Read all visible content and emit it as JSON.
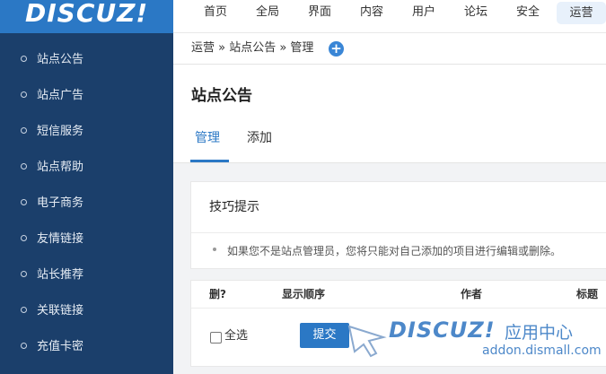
{
  "logo": {
    "text": "DISCUZ!"
  },
  "topnav": {
    "items": [
      "首页",
      "全局",
      "界面",
      "内容",
      "用户",
      "论坛",
      "安全",
      "运营"
    ],
    "active": "运营"
  },
  "sidebar": {
    "items": [
      "站点公告",
      "站点广告",
      "短信服务",
      "站点帮助",
      "电子商务",
      "友情链接",
      "站长推荐",
      "关联链接",
      "充值卡密"
    ]
  },
  "breadcrumb": {
    "text": "运营 » 站点公告 » 管理"
  },
  "page": {
    "title": "站点公告",
    "tabs": [
      "管理",
      "添加"
    ]
  },
  "tips": {
    "title": "技巧提示",
    "text": "如果您不是站点管理员，您将只能对自己添加的项目进行编辑或删除。"
  },
  "table": {
    "headers": [
      "删?",
      "显示顺序",
      "作者",
      "标题"
    ],
    "select_all": "全选",
    "submit": "提交"
  },
  "watermark": {
    "brand": "DISCUZ!",
    "center": "应用中心",
    "url": "addon.dismall.com"
  },
  "colors": {
    "primary": "#2b78c5",
    "sidebar": "#1b3f6b"
  }
}
